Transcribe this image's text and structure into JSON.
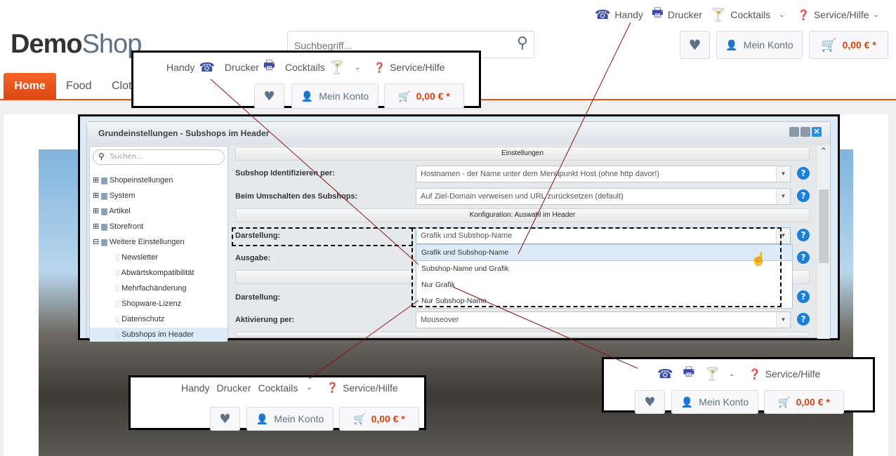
{
  "top_nav": {
    "items": [
      {
        "label": "Handy",
        "icon": "phone-icon"
      },
      {
        "label": "Drucker",
        "icon": "printer-icon"
      },
      {
        "label": "Cocktails",
        "icon": "cocktail-icon"
      }
    ],
    "service": "Service/Hilfe"
  },
  "logo": {
    "part1": "Demo",
    "part2": "Shop"
  },
  "search": {
    "placeholder": "Suchbegriff..."
  },
  "account": {
    "label": "Mein Konto"
  },
  "cart": {
    "price": "0,00 € *"
  },
  "main_nav": {
    "items": [
      "Home",
      "Food",
      "Clot"
    ]
  },
  "window": {
    "title": "Grundeinstellungen - Subshops im Header",
    "search_placeholder": "Suchen...",
    "tree": [
      "Shopeinstellungen",
      "System",
      "Artikel",
      "Storefront",
      "Weitere Einstellungen"
    ],
    "tree_children": [
      "Newsletter",
      "Abwärtskompatibilität",
      "Mehrfachänderung",
      "Shopware-Lizenz",
      "Datenschutz",
      "Subshops im Header"
    ],
    "section1": "Einstellungen",
    "section2": "Konfiguration: Auswahl im Header",
    "fields": {
      "identify_label": "Subshop Identifizieren per:",
      "identify_value": "Hostnamen - der Name unter dem Menüpunkt Host (ohne http davor!)",
      "switch_label": "Beim Umschalten des Subshops:",
      "switch_value": "Auf Ziel-Domain verweisen und URL zurücksetzen (default)",
      "display_label": "Darstellung:",
      "display_value": "Grafik und Subshop-Name",
      "output_label": "Ausgabe:",
      "display2_label": "Darstellung:",
      "activation_label": "Aktivierung per:",
      "activation_value": "Mouseover"
    },
    "options": [
      "Grafik und Subshop-Name",
      "Subshop-Name und Grafik",
      "Nur Grafik",
      "Nur Subshop-Name"
    ]
  },
  "colors": {
    "accent": "#e8531a",
    "icon": "#3b4ca8",
    "price": "#d9400b",
    "help": "#1a7fd8"
  }
}
